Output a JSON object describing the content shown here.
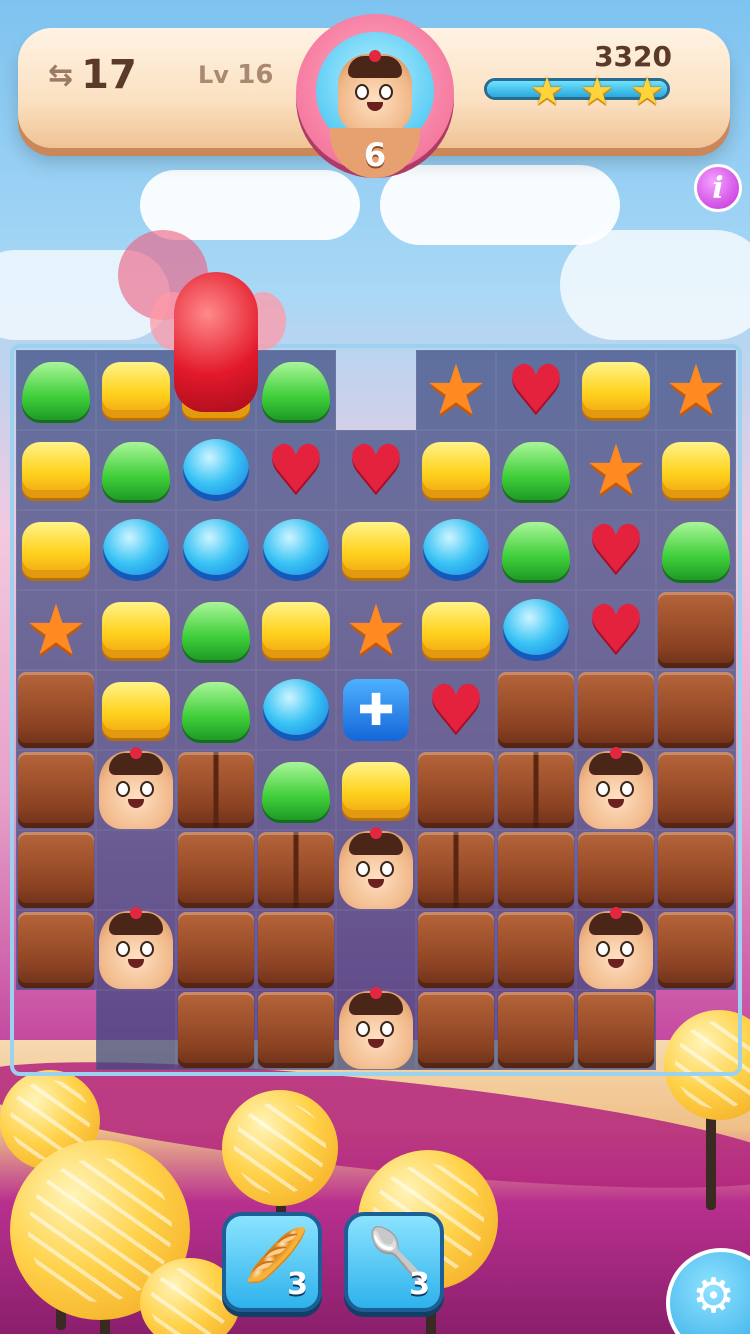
{
  "hud": {
    "moves_icon": "swap-arrows-icon",
    "moves": "17",
    "level_prefix": "Lv",
    "level": "16",
    "target_icon": "cupcake-character-icon",
    "target_remaining": "6",
    "score": "3320",
    "progress_fraction": 1.0,
    "stars_earned": 3,
    "star_symbol": "★"
  },
  "info_button": {
    "symbol": "i",
    "icon": "info-icon"
  },
  "boosters": [
    {
      "name": "rolling-pin",
      "icon": "rolling-pin-icon",
      "symbol": "🥖",
      "count": "3"
    },
    {
      "name": "spoon",
      "icon": "spoon-icon",
      "symbol": "🥄",
      "count": "3"
    }
  ],
  "settings": {
    "icon": "gear-icon",
    "symbol": "⚙"
  },
  "board": {
    "columns": 9,
    "rows": 9,
    "legend": {
      "Y": "yellow-cake",
      "G": "green-drop",
      "B": "blue-macaron",
      "R": "red-heart",
      "O": "orange-star",
      "C": "chocolate-block",
      "S": "chocolate-block-split",
      "K": "cupcake-character",
      "X": "blue-gift-box",
      ".": "empty-cell",
      "-": "no-cell"
    },
    "grid": [
      [
        "G",
        "Y",
        "Y",
        "G",
        "-",
        "O",
        "R",
        "Y",
        "O"
      ],
      [
        "Y",
        "G",
        "B",
        "R",
        "R",
        "Y",
        "G",
        "O",
        "Y"
      ],
      [
        "Y",
        "B",
        "B",
        "B",
        "Y",
        "B",
        "G",
        "R",
        "G"
      ],
      [
        "O",
        "Y",
        "G",
        "Y",
        "O",
        "Y",
        "B",
        "R",
        "C"
      ],
      [
        "C",
        "Y",
        "G",
        "B",
        "X",
        "R",
        "C",
        "C",
        "C"
      ],
      [
        "C",
        "K",
        "S",
        "G",
        "Y",
        "C",
        "S",
        "K",
        "C"
      ],
      [
        "C",
        ".",
        "C",
        "S",
        "K",
        "S",
        "C",
        "C",
        "C"
      ],
      [
        "C",
        "K",
        "C",
        "C",
        ".",
        "C",
        "C",
        "K",
        "C"
      ],
      [
        "-",
        ".",
        "C",
        "C",
        "K",
        "C",
        "C",
        "C",
        "-"
      ]
    ]
  },
  "colors": {
    "board_cell": "#3a4880",
    "chocolate": "#8c4323",
    "accent_pink": "#f57aa0",
    "booster_blue": "#2fb2ec"
  }
}
